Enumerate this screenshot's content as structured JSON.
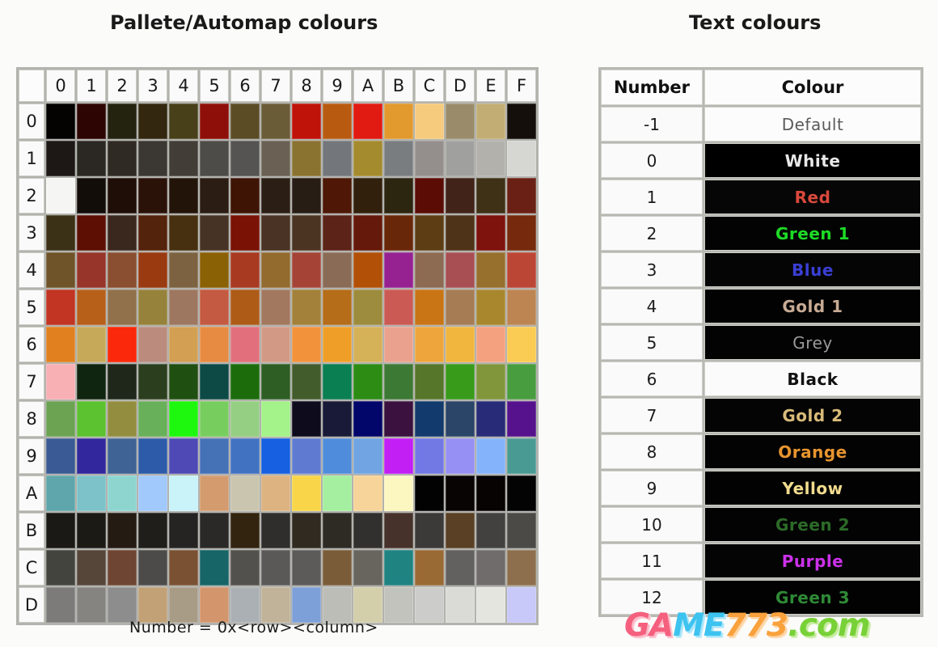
{
  "headings": {
    "palette": "Pallete/Automap colours",
    "text": "Text colours"
  },
  "caption": "Number = 0x<row><column>",
  "watermark": {
    "part1": "GA",
    "part2": "ME",
    "part3": "773",
    "part4": ".com",
    "colors": {
      "pink": "#f4607e",
      "blue": "#3cc3f0",
      "orange": "#f9a13c",
      "green": "#78d137"
    }
  },
  "palette": {
    "column_headers": [
      "0",
      "1",
      "2",
      "3",
      "4",
      "5",
      "6",
      "7",
      "8",
      "9",
      "A",
      "B",
      "C",
      "D",
      "E",
      "F"
    ],
    "row_headers": [
      "0",
      "1",
      "2",
      "3",
      "4",
      "5",
      "6",
      "7",
      "8",
      "9",
      "A",
      "B",
      "C",
      "D"
    ],
    "rows": [
      {
        "label": "0",
        "colors": [
          "#050302",
          "#2d0503",
          "#23230f",
          "#33270f",
          "#474019",
          "#8e0f09",
          "#5b4c25",
          "#6b5c38",
          "#bf1209",
          "#b85b11",
          "#e11a12",
          "#e2992d",
          "#f6cb7e",
          "#9a8c6b",
          "#c2ae74",
          "#140f0b"
        ]
      },
      {
        "label": "1",
        "colors": [
          "#1d1816",
          "#2b2823",
          "#2f2b24",
          "#3b3733",
          "#423d36",
          "#4e4c48",
          "#565452",
          "#6a6054",
          "#8a7230",
          "#73767a",
          "#a48b2e",
          "#7a7d80",
          "#948f8c",
          "#a0a09e",
          "#b2b1ac",
          "#d6d6d3"
        ]
      },
      {
        "label": "2",
        "colors": [
          "#f5f5f3",
          "#120d09",
          "#1f0d07",
          "#2a1209",
          "#231409",
          "#2b1d13",
          "#3e1405",
          "#2b1f15",
          "#281d15",
          "#4e1706",
          "#30200c",
          "#2c250f",
          "#5a0c05",
          "#42231a",
          "#3e3116",
          "#6b2015"
        ]
      },
      {
        "label": "3",
        "colors": [
          "#3b3117",
          "#5d0f04",
          "#3a281f",
          "#54230b",
          "#46300f",
          "#463325",
          "#7a1206",
          "#4a3324",
          "#4b3421",
          "#5c2318",
          "#65190a",
          "#69270a",
          "#5d3e14",
          "#4f3318",
          "#7e120d",
          "#76290d"
        ]
      },
      {
        "label": "4",
        "colors": [
          "#6f5329",
          "#97352a",
          "#8a4e30",
          "#9a3a10",
          "#7c6240",
          "#8b6106",
          "#a83a22",
          "#936b2f",
          "#a54436",
          "#8a6b56",
          "#b25008",
          "#962292",
          "#8d6a52",
          "#a84f53",
          "#96702c",
          "#bc4636"
        ]
      },
      {
        "label": "5",
        "colors": [
          "#c23523",
          "#b7601a",
          "#90714c",
          "#97823b",
          "#9d7760",
          "#c35a41",
          "#ae5b18",
          "#a2785f",
          "#a3813a",
          "#b56d19",
          "#9d8c3e",
          "#cb5a55",
          "#c97516",
          "#a67c55",
          "#a9872d",
          "#bd8551"
        ]
      },
      {
        "label": "6",
        "colors": [
          "#e0801f",
          "#c7a95a",
          "#fb280b",
          "#bb8c7d",
          "#d29f53",
          "#e78b43",
          "#e2707c",
          "#d29a85",
          "#f2933c",
          "#ef9f28",
          "#d5b158",
          "#eaa28e",
          "#eea53c",
          "#f0b63e",
          "#f4a17f",
          "#fbcc53"
        ]
      },
      {
        "label": "7",
        "colors": [
          "#f8b0b5",
          "#0f250f",
          "#1e2719",
          "#2b3f1f",
          "#204f12",
          "#0d4a46",
          "#1c6c0c",
          "#2e5e24",
          "#435c2c",
          "#0a7f52",
          "#2c8c14",
          "#3c7934",
          "#567629",
          "#389b1a",
          "#81953b",
          "#489d3e"
        ]
      },
      {
        "label": "8",
        "colors": [
          "#6ba352",
          "#5cc230",
          "#938e3f",
          "#68b059",
          "#1ef80e",
          "#78cd5f",
          "#95cf83",
          "#a4f28a",
          "#0d0b1c",
          "#191a38",
          "#020569",
          "#3a113f",
          "#123a6d",
          "#2a4568",
          "#282b77",
          "#56128c"
        ]
      },
      {
        "label": "9",
        "colors": [
          "#3a5a95",
          "#32279c",
          "#3f6394",
          "#2d5ba9",
          "#4e49b4",
          "#4571b7",
          "#4172c2",
          "#1660e1",
          "#5e7bd1",
          "#4f8cdb",
          "#70a4e2",
          "#c21ff5",
          "#7379e4",
          "#9690f5",
          "#84b3fb",
          "#499a93"
        ]
      },
      {
        "label": "A",
        "colors": [
          "#5ea6ab",
          "#7cc2c8",
          "#8ed5d0",
          "#a1c9fb",
          "#c9f2f9",
          "#d49b6e",
          "#cac5af",
          "#ddb382",
          "#f9d54a",
          "#a5efa0",
          "#f7d59a",
          "#fcf6c1",
          "#020202",
          "#070403",
          "#060302",
          "#030303"
        ]
      },
      {
        "label": "B",
        "colors": [
          "#1b1916",
          "#1b1a15",
          "#241c13",
          "#1f1e1b",
          "#262423",
          "#2b2927",
          "#32240f",
          "#302e2c",
          "#312a20",
          "#2e2b25",
          "#32302e",
          "#46322b",
          "#3b3a39",
          "#5a4024",
          "#424140",
          "#4c4a46"
        ]
      },
      {
        "label": "C",
        "colors": [
          "#44443f",
          "#554639",
          "#6e4532",
          "#4d4b4a",
          "#7a5133",
          "#176566",
          "#53514d",
          "#5b5958",
          "#5d5b5a",
          "#7a5c38",
          "#67655e",
          "#1f8382",
          "#9a6a35",
          "#626160",
          "#6f6c6b",
          "#8d6f4d"
        ]
      },
      {
        "label": "D",
        "colors": [
          "#7c7b7a",
          "#868481",
          "#8c8d8c",
          "#c1a175",
          "#a89c86",
          "#d2956c",
          "#aab0b3",
          "#c1b399",
          "#7da0d8",
          "#bdbdb8",
          "#d4cfab",
          "#c3c3be",
          "#ccccca",
          "#dadad6",
          "#e5e5e0",
          "#c8c8f9"
        ]
      }
    ]
  },
  "text_colours": {
    "headers": {
      "number": "Number",
      "colour": "Colour"
    },
    "rows": [
      {
        "number": "-1",
        "name": "Default",
        "bg": "#fcfcfc",
        "fg": "#5a5a5a",
        "weight": "normal"
      },
      {
        "number": "0",
        "name": "White",
        "bg": "#000000",
        "fg": "#e8e8e8",
        "weight": "bold"
      },
      {
        "number": "1",
        "name": "Red",
        "bg": "#060606",
        "fg": "#d9493c",
        "weight": "bold"
      },
      {
        "number": "2",
        "name": "Green 1",
        "bg": "#030303",
        "fg": "#1ddb26",
        "weight": "bold"
      },
      {
        "number": "3",
        "name": "Blue",
        "bg": "#050505",
        "fg": "#3a3fd4",
        "weight": "bold"
      },
      {
        "number": "4",
        "name": "Gold 1",
        "bg": "#020202",
        "fg": "#c8ab94",
        "weight": "bold"
      },
      {
        "number": "5",
        "name": "Grey",
        "bg": "#030303",
        "fg": "#9a9a9a",
        "weight": "normal"
      },
      {
        "number": "6",
        "name": "Black",
        "bg": "#fbfbfb",
        "fg": "#111111",
        "weight": "bold"
      },
      {
        "number": "7",
        "name": "Gold 2",
        "bg": "#040404",
        "fg": "#d9bb7a",
        "weight": "bold"
      },
      {
        "number": "8",
        "name": "Orange",
        "bg": "#030303",
        "fg": "#e8942f",
        "weight": "bold"
      },
      {
        "number": "9",
        "name": "Yellow",
        "bg": "#020202",
        "fg": "#f2dc8e",
        "weight": "bold"
      },
      {
        "number": "10",
        "name": "Green 2",
        "bg": "#030303",
        "fg": "#2c6b28",
        "weight": "bold"
      },
      {
        "number": "11",
        "name": "Purple",
        "bg": "#040404",
        "fg": "#cc31ea",
        "weight": "bold"
      },
      {
        "number": "12",
        "name": "Green 3",
        "bg": "#020202",
        "fg": "#2f8a36",
        "weight": "bold"
      }
    ]
  }
}
